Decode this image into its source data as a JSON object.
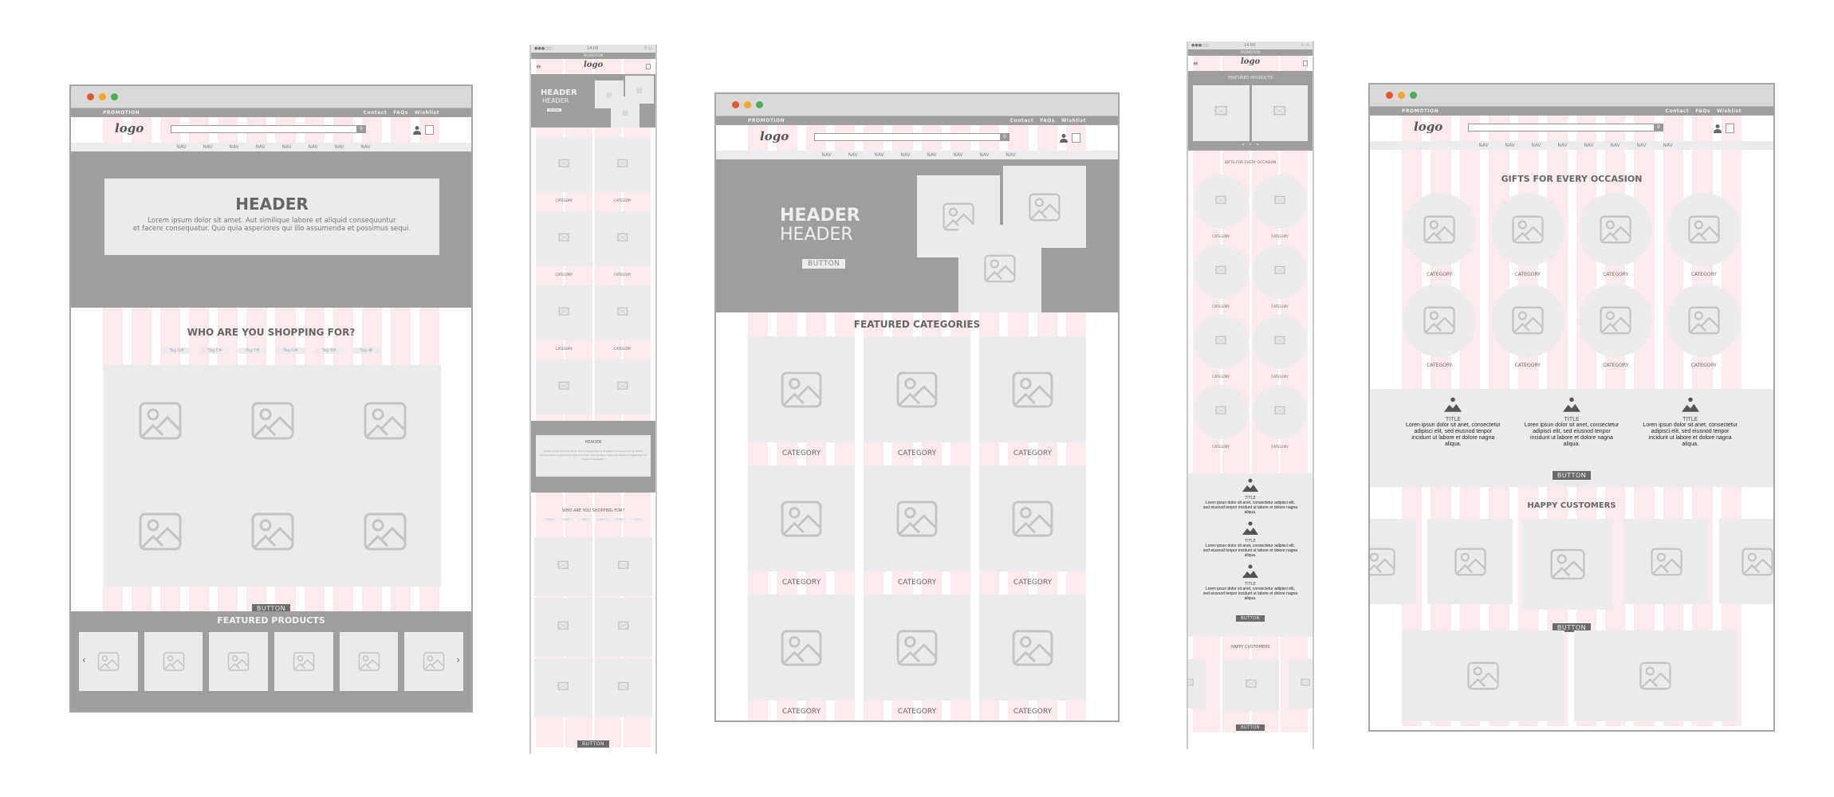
{
  "shared": {
    "promotion": "PROMOTION",
    "top_links": [
      "Contact",
      "FAQs",
      "Wishlist"
    ],
    "logo": "logo",
    "nav": [
      "NAV",
      "NAV",
      "NAV",
      "NAV",
      "NAV",
      "NAV",
      "NAV",
      "NAV"
    ],
    "window_dots": [
      "#e05a2b",
      "#f5a623",
      "#4caf50"
    ],
    "status_bar": {
      "signal": "●●●○○",
      "time": "14:00",
      "icons": "⌔ ▭"
    }
  },
  "desktop1": {
    "hero_title": "HEADER",
    "hero_text": [
      "Lorem ipsum dolor sit amet. Aut similique labore et aliquid consequuntur",
      "et facere consequatur. Quo quia asperiores qui illo assumenda et possimus sequi."
    ],
    "section_title": "WHO ARE YOU SHOPPING FOR?",
    "tags": [
      "Tag D#",
      "Tag E#",
      "Tag F#",
      "Tag G#",
      "Tag H#",
      "Tag I#"
    ],
    "button": "BUTTON",
    "featured_title": "FEATURED PRODUCTS",
    "prev": "‹",
    "next": "›"
  },
  "mobile1": {
    "hero_title": "HEADER",
    "hero_subtitle": "HEADER",
    "hero_button": "BUTTON",
    "categories": [
      "CATEGORY",
      "CATEGORY",
      "CATEGORY",
      "CATEGORY",
      "CATEGORY",
      "CATEGORY",
      "CATEGORY",
      "CATEGORY"
    ],
    "header_block_title": "HEADER",
    "header_block_text": "Lorem ipsum dolor sit amet. Aut similique labore et aliquid consequuntur et facere consequatur. Lorem ipsum dolor sit amet. Aut similique labore et aliquid consequuntur et facere consequatur.",
    "section_title": "WHO ARE YOU SHOPPING FOR?",
    "tags": [
      "Tag D#",
      "Tag E#",
      "Tag F#",
      "Tag G#",
      "Tag H#",
      "Tag I#"
    ],
    "button": "BUTTON"
  },
  "desktop2": {
    "hero_title": "HEADER",
    "hero_subtitle": "HEADER",
    "hero_button": "BUTTON",
    "section_title": "FEATURED CATEGORIES",
    "categories": [
      "CATEGORY",
      "CATEGORY",
      "CATEGORY",
      "CATEGORY",
      "CATEGORY",
      "CATEGORY",
      "CATEGORY",
      "CATEGORY",
      "CATEGORY"
    ]
  },
  "mobile2": {
    "featured_title": "FEATURED PRODUCTS",
    "carousel_dots": 3,
    "gifts_title": "GIFTS FOR EVERY OCCASION",
    "categories": [
      "CATEGORY",
      "CATEGORY",
      "CATEGORY",
      "CATEGORY",
      "CATEGORY",
      "CATEGORY",
      "CATEGORY",
      "CATEGORY"
    ],
    "features": [
      {
        "title": "TITLE",
        "text": "Loren ipsun dolor sit anet, consectetur adipisci elit, sed eiusnod tenpor incidunt ut labore et dolore nagna aliqua."
      },
      {
        "title": "TITLE",
        "text": "Loren ipsun dolor sit anet, consectetur adipisci elit, sed eiusnod tenpor incidunt ut labore et dolore nagna aliqua."
      },
      {
        "title": "TITLE",
        "text": "Loren ipsun dolor sit anet, consectetur adipisci elit, sed eiusnod tenpor incidunt ut labore et dolore nagna aliqua."
      }
    ],
    "button": "BUTTON",
    "happy_title": "HAPPY CUSTOMERS",
    "button2": "BUTTON"
  },
  "desktop3": {
    "gifts_title": "GIFTS FOR EVERY OCCASION",
    "categories": [
      "CATEGORY",
      "CATEGORY",
      "CATEGORY",
      "CATEGORY",
      "CATEGORY",
      "CATEGORY",
      "CATEGORY",
      "CATEGORY"
    ],
    "features": [
      {
        "title": "TITLE",
        "text": "Loren ipsun dolor sit anet, consectetur adipisci elit, sed eiusnod tenpor incidunt ut labore et dolore nagna aliqua."
      },
      {
        "title": "TITLE",
        "text": "Loren ipsun dolor sit anet, consectetur adipisci elit, sed eiusnod tenpor incidunt ut labore et dolore nagna aliqua."
      },
      {
        "title": "TITLE",
        "text": "Loren ipsun dolor sit anet, consectetur adipisci elit, sed eiusnod tenpor incidunt ut labore et dolore nagna aliqua."
      }
    ],
    "button": "BUTTON",
    "happy_title": "HAPPY CUSTOMERS",
    "button2": "BUTTON"
  }
}
